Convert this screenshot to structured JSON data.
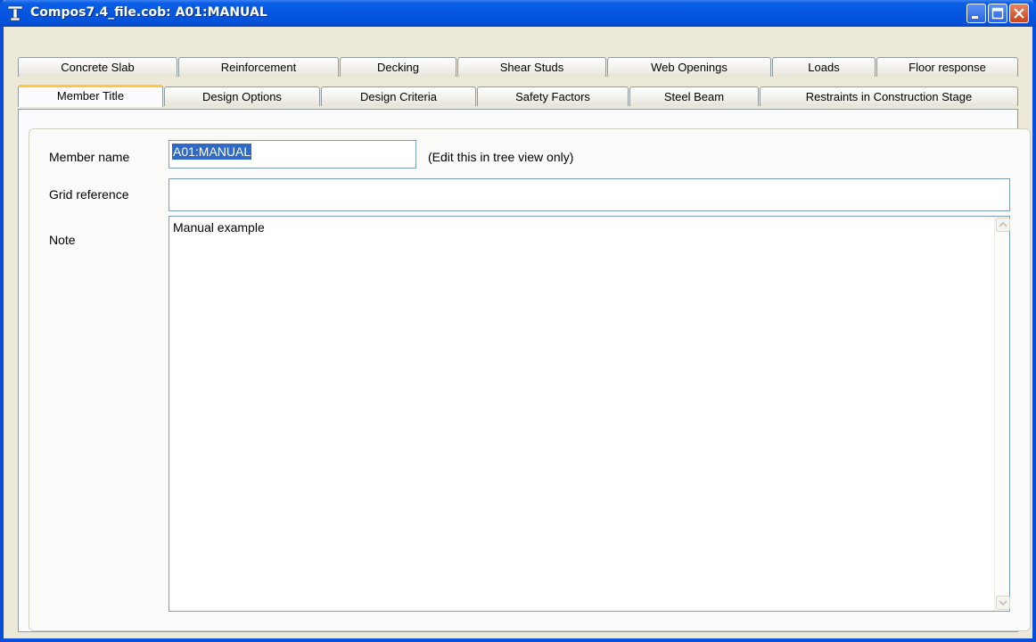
{
  "window": {
    "title": "Compos7.4_file.cob: A01:MANUAL",
    "controls": {
      "minimize": "minimize",
      "maximize": "maximize",
      "close": "close"
    }
  },
  "tabs": {
    "back_row": [
      "Concrete Slab",
      "Reinforcement",
      "Decking",
      "Shear Studs",
      "Web Openings",
      "Loads",
      "Floor response"
    ],
    "front_row": [
      "Member Title",
      "Design Options",
      "Design Criteria",
      "Safety Factors",
      "Steel Beam",
      "Restraints in Construction Stage"
    ],
    "active": "Member Title"
  },
  "form": {
    "member_name": {
      "label": "Member name",
      "value": "A01:MANUAL",
      "hint": "(Edit this in tree view only)"
    },
    "grid_reference": {
      "label": "Grid reference",
      "value": ""
    },
    "note": {
      "label": "Note",
      "value": "Manual example"
    }
  },
  "colors": {
    "titlebar": "#0655e0",
    "selection": "#316ac5",
    "active_tab_accent": "#ffc83c",
    "close_button": "#c9431e"
  },
  "icons": {
    "app": "i-beam-icon",
    "scroll_up": "scroll-up-arrow-icon",
    "scroll_down": "scroll-down-arrow-icon"
  }
}
